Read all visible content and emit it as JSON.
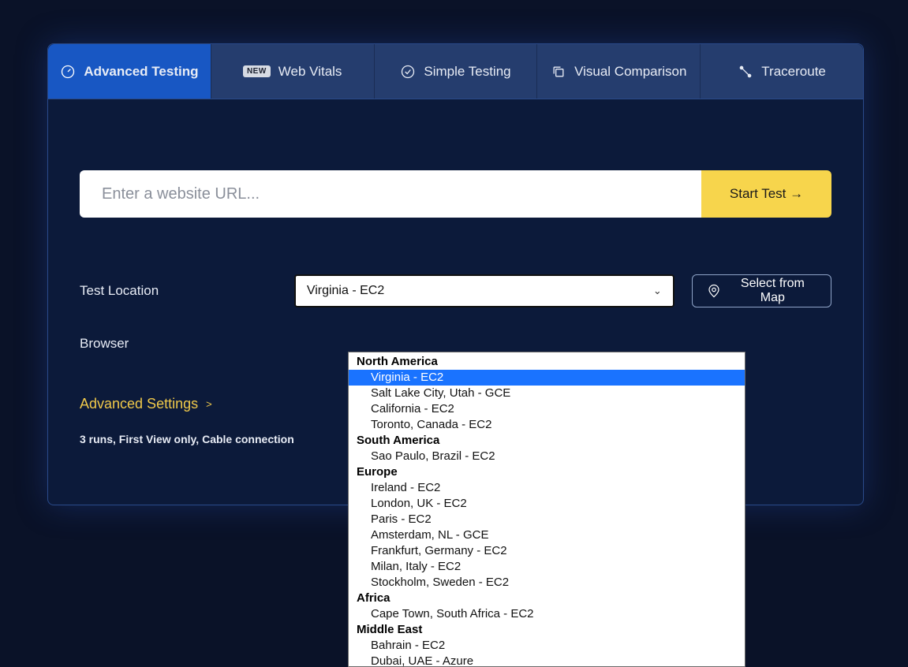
{
  "tabs": {
    "advanced": "Advanced Testing",
    "webvitals_badge": "NEW",
    "webvitals": "Web Vitals",
    "simple": "Simple Testing",
    "visual": "Visual Comparison",
    "traceroute": "Traceroute"
  },
  "url": {
    "placeholder": "Enter a website URL...",
    "start_label": "Start Test →"
  },
  "location": {
    "label": "Test Location",
    "selected": "Virginia - EC2",
    "map_button": "Select from Map",
    "groups": [
      {
        "name": "North America",
        "items": [
          "Virginia - EC2",
          "Salt Lake City, Utah - GCE",
          "California - EC2",
          "Toronto, Canada - EC2"
        ]
      },
      {
        "name": "South America",
        "items": [
          "Sao Paulo, Brazil - EC2"
        ]
      },
      {
        "name": "Europe",
        "items": [
          "Ireland - EC2",
          "London, UK - EC2",
          "Paris - EC2",
          "Amsterdam, NL - GCE",
          "Frankfurt, Germany - EC2",
          "Milan, Italy - EC2",
          "Stockholm, Sweden - EC2"
        ]
      },
      {
        "name": "Africa",
        "items": [
          "Cape Town, South Africa - EC2"
        ]
      },
      {
        "name": "Middle East",
        "items": [
          "Bahrain - EC2",
          "Dubai, UAE - Azure"
        ]
      }
    ]
  },
  "browser": {
    "label": "Browser"
  },
  "advanced": {
    "label": "Advanced Settings",
    "summary": "3 runs, First View only, Cable connection"
  }
}
